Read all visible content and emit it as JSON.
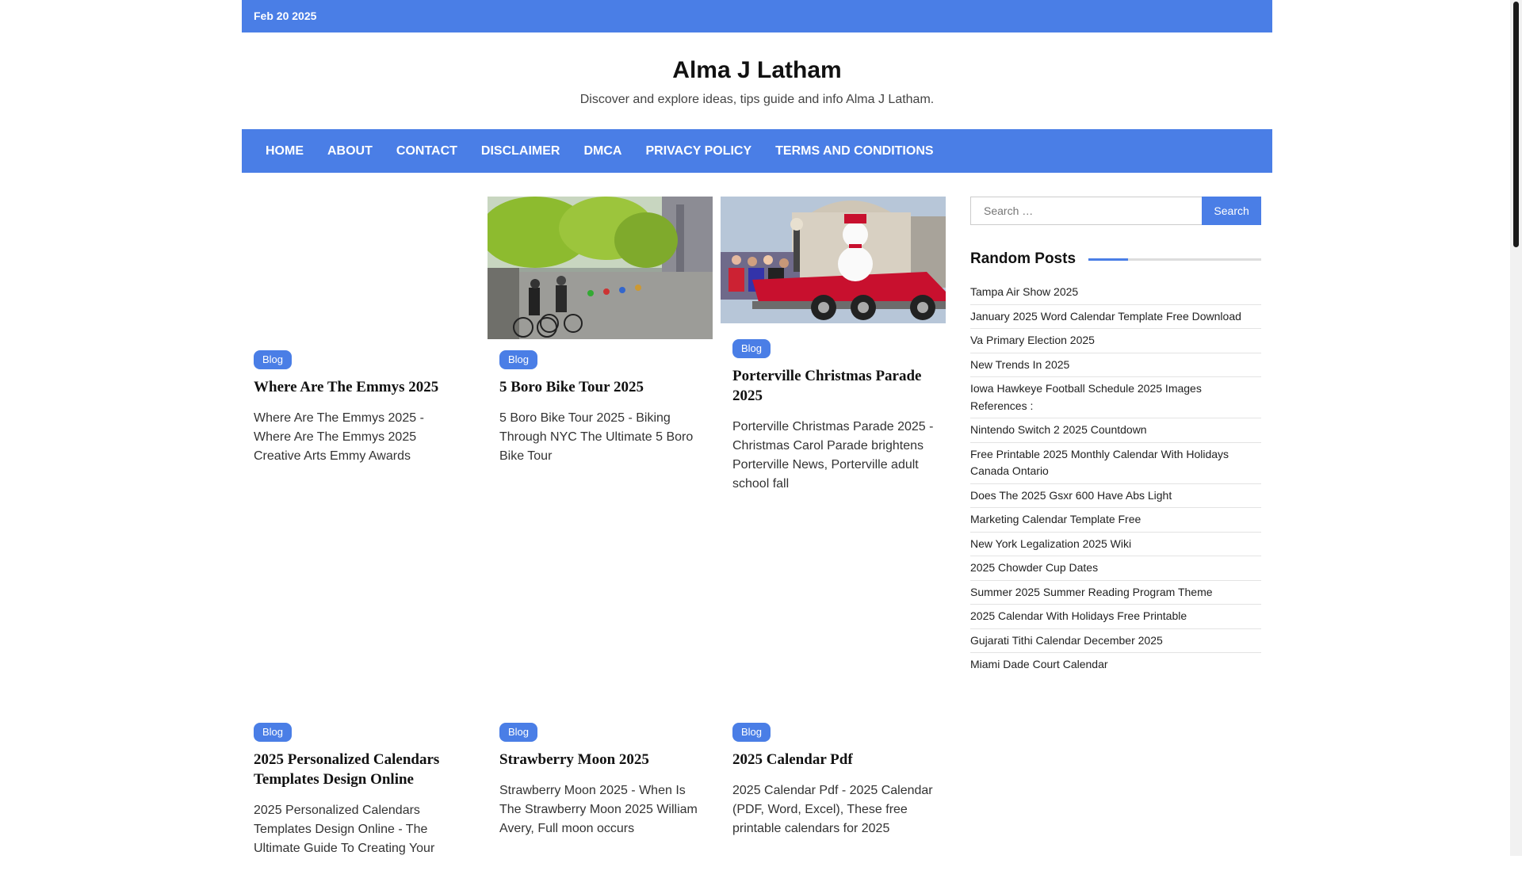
{
  "topbar": {
    "date": "Feb 20 2025"
  },
  "header": {
    "title": "Alma J Latham",
    "description": "Discover and explore ideas, tips guide and info Alma J Latham."
  },
  "nav": [
    "HOME",
    "ABOUT",
    "CONTACT",
    "DISCLAIMER",
    "DMCA",
    "PRIVACY POLICY",
    "TERMS AND CONDITIONS"
  ],
  "posts": [
    {
      "category": "Blog",
      "title": "Where Are The Emmys 2025",
      "excerpt": "Where Are The Emmys 2025 - Where Are The Emmys 2025 Creative Arts Emmy Awards",
      "image": "none"
    },
    {
      "category": "Blog",
      "title": "5 Boro Bike Tour 2025",
      "excerpt": "5 Boro Bike Tour 2025 - Biking Through NYC The Ultimate 5 Boro Bike Tour",
      "image": "cyclists-photo"
    },
    {
      "category": "Blog",
      "title": "Porterville Christmas Parade 2025",
      "excerpt": "Porterville Christmas Parade 2025 - Christmas Carol Parade brightens Porterville News, Porterville adult school fall",
      "image": "parade-float-photo"
    },
    {
      "category": "Blog",
      "title": "2025 Personalized Calendars Templates Design Online",
      "excerpt": "2025 Personalized Calendars Templates Design Online - The Ultimate Guide To Creating Your",
      "image": "none"
    },
    {
      "category": "Blog",
      "title": "Strawberry Moon 2025",
      "excerpt": "Strawberry Moon 2025 - When Is The Strawberry Moon 2025 William Avery, Full moon occurs",
      "image": "none"
    },
    {
      "category": "Blog",
      "title": "2025 Calendar Pdf",
      "excerpt": "2025 Calendar Pdf - 2025 Calendar (PDF, Word, Excel), These free printable calendars for 2025",
      "image": "none"
    }
  ],
  "sidebar": {
    "search_placeholder": "Search …",
    "search_button": "Search",
    "widget_title": "Random Posts",
    "random_posts": [
      "Tampa Air Show 2025",
      "January 2025 Word Calendar Template Free Download",
      "Va Primary Election 2025",
      "New Trends In 2025",
      "Iowa Hawkeye Football Schedule 2025 Images References :",
      "Nintendo Switch 2 2025 Countdown",
      "Free Printable 2025 Monthly Calendar With Holidays Canada Ontario",
      "Does The 2025 Gsxr 600 Have Abs Light",
      "Marketing Calendar Template Free",
      "New York Legalization 2025 Wiki",
      "2025 Chowder Cup Dates",
      "Summer 2025 Summer Reading Program Theme",
      "2025 Calendar With Holidays Free Printable",
      "Gujarati Tithi Calendar December 2025",
      "Miami Dade Court Calendar"
    ]
  },
  "colors": {
    "accent": "#4a7ee6",
    "text": "#222222"
  }
}
